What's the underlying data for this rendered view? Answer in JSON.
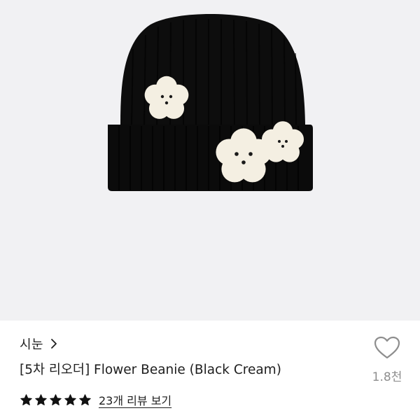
{
  "product_image": {
    "alt": "Flower Beanie (Black Cream)",
    "background_color": "#f1f1f3",
    "beanie_color": "#0d0d0d",
    "flower_color": "#f4efe2"
  },
  "brand": {
    "name": "시눈",
    "chevron_icon": "chevron-right-icon"
  },
  "product": {
    "title": "[5차 리오더] Flower Beanie (Black Cream)"
  },
  "rating": {
    "stars": 5,
    "max_stars": 5,
    "star_icon": "star-icon",
    "star_color": "#111111",
    "review_link_text": "23개 리뷰 보기"
  },
  "like": {
    "icon": "heart-outline-icon",
    "count": "1.8천",
    "color": "#8e8e8e"
  }
}
